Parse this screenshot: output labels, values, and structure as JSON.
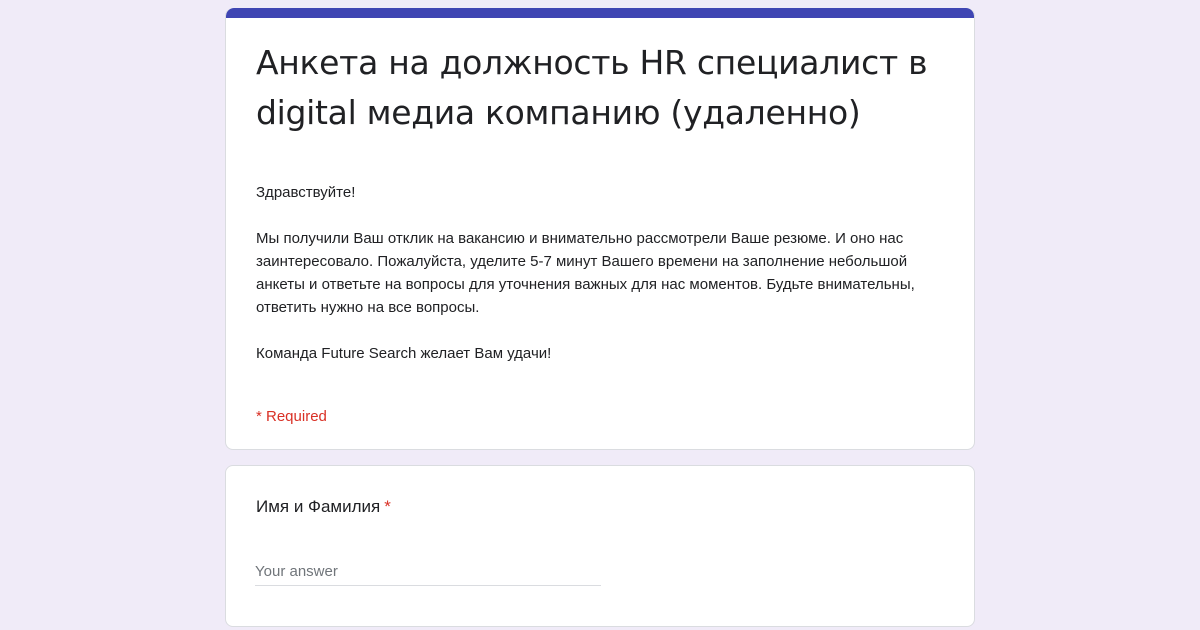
{
  "theme": {
    "accent_color": "#3f45b3",
    "background_color": "#f0ebf8",
    "required_color": "#d93025"
  },
  "form": {
    "title": "Анкета на должность HR специалист в digital медиа компанию (удаленно)",
    "description": [
      "Здравствуйте!",
      "Мы получили Ваш отклик на вакансию и внимательно рассмотрели Ваше резюме. И оно нас заинтересовало. Пожалуйста, уделите 5-7 минут Вашего времени на заполнение небольшой анкеты и ответьте на вопросы для уточнения важных для нас моментов. Будьте внимательны, ответить нужно на все вопросы.",
      "Команда Future Search желает Вам удачи!"
    ],
    "required_note": "* Required"
  },
  "questions": [
    {
      "label": "Имя и Фамилия",
      "required_marker": "*",
      "placeholder": "Your answer",
      "value": ""
    }
  ]
}
